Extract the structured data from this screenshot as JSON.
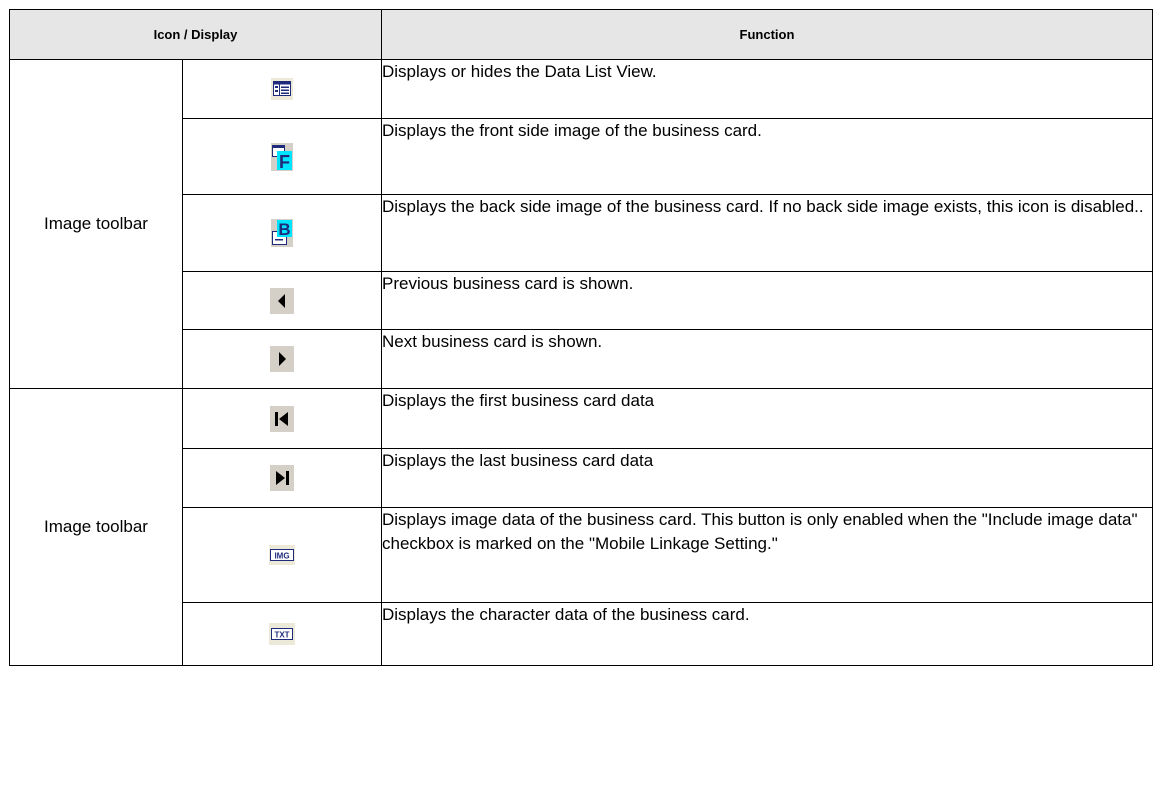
{
  "headers": {
    "icon_display": "Icon / Display",
    "function": "Function"
  },
  "groups": [
    {
      "label": "Image toolbar",
      "rows": [
        {
          "icon": "data-list-view-icon",
          "function": "Displays or hides the Data List View."
        },
        {
          "icon": "front-side-icon",
          "icon_text": "F",
          "function": "Displays the front side image of the business card."
        },
        {
          "icon": "back-side-icon",
          "icon_text": "B",
          "function": "Displays the back side image of the business card. If no back side image exists, this icon is disabled.."
        },
        {
          "icon": "previous-icon",
          "function": "Previous business card is shown."
        },
        {
          "icon": "next-icon",
          "function": "Next business card is shown."
        }
      ]
    },
    {
      "label": "Image toolbar",
      "rows": [
        {
          "icon": "first-record-icon",
          "function": "Displays the first business card data"
        },
        {
          "icon": "last-record-icon",
          "function": "Displays the last business card data"
        },
        {
          "icon": "image-data-icon",
          "icon_text": "IMG",
          "function": "Displays image data of the business card. This button is only enabled when the \"Include image data\" checkbox is marked on the \"Mobile Linkage Setting.\""
        },
        {
          "icon": "text-data-icon",
          "icon_text": "TXT",
          "function": "Displays the character data of the business card."
        }
      ]
    }
  ]
}
